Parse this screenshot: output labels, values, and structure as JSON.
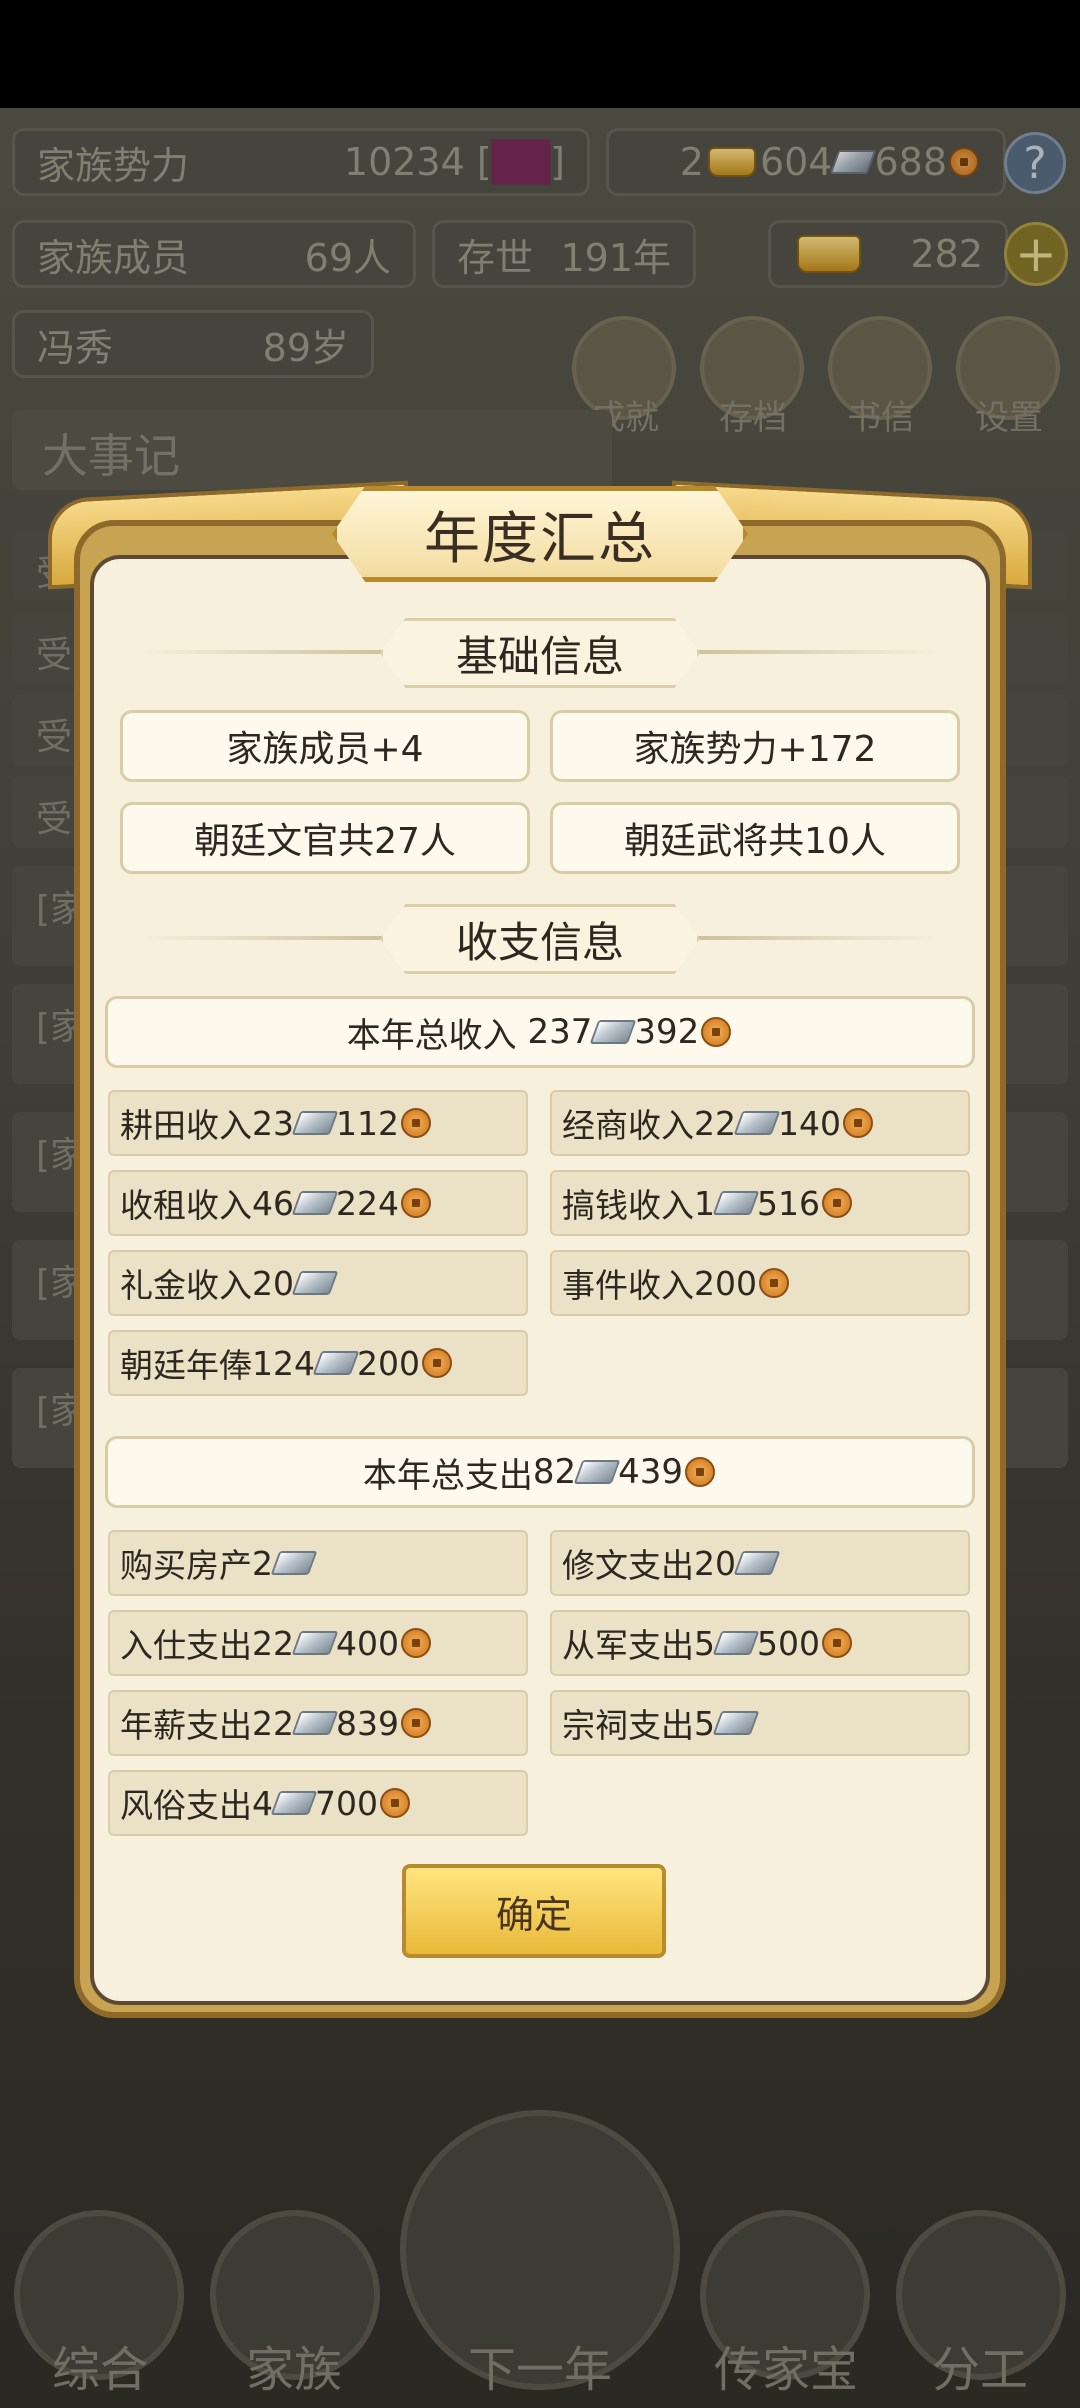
{
  "hud": {
    "power_label": "家族势力",
    "power_value": "10234",
    "power_rank_open": "[",
    "power_rank": "██",
    "power_rank_close": "]",
    "gold": "2",
    "silver": "604",
    "coins": "688",
    "help": "?",
    "members_label": "家族成员",
    "members_value": "69人",
    "exist_label": "存世",
    "exist_value": "191年",
    "ingots": "282",
    "add": "+",
    "leader_name": "冯秀",
    "leader_age": "89岁",
    "menu": [
      "成就",
      "存档",
      "书信",
      "设置"
    ],
    "events_title": "大事记",
    "bg_rows": [
      "受",
      "受",
      "受",
      "受",
      "[家",
      "[家",
      "[家",
      "[家",
      "[家"
    ]
  },
  "modal": {
    "title": "年度汇总",
    "basic_header": "基础信息",
    "basic": [
      "家族成员+4",
      "家族势力+172",
      "朝廷文官共27人",
      "朝廷武将共10人"
    ],
    "finance_header": "收支信息",
    "income_total": {
      "label": "本年总收入",
      "silver": "237",
      "coins": "392"
    },
    "income_items": [
      {
        "label": "耕田收入",
        "silver": "23",
        "coins": "112"
      },
      {
        "label": "经商收入",
        "silver": "22",
        "coins": "140"
      },
      {
        "label": "收租收入",
        "silver": "46",
        "coins": "224"
      },
      {
        "label": "搞钱收入",
        "silver": "1",
        "coins": "516"
      },
      {
        "label": "礼金收入",
        "silver": "20",
        "coins": ""
      },
      {
        "label": "事件收入",
        "silver": "",
        "coins": "200"
      },
      {
        "label": "朝廷年俸",
        "silver": "124",
        "coins": "200"
      }
    ],
    "expense_total": {
      "label": "本年总支出",
      "silver": "82",
      "coins": "439"
    },
    "expense_items": [
      {
        "label": "购买房产",
        "silver": "2",
        "coins": ""
      },
      {
        "label": "修文支出",
        "silver": "20",
        "coins": ""
      },
      {
        "label": "入仕支出",
        "silver": "22",
        "coins": "400"
      },
      {
        "label": "从军支出",
        "silver": "5",
        "coins": "500"
      },
      {
        "label": "年薪支出",
        "silver": "22",
        "coins": "839"
      },
      {
        "label": "宗祠支出",
        "silver": "5",
        "coins": ""
      },
      {
        "label": "风俗支出",
        "silver": "4",
        "coins": "700"
      }
    ],
    "confirm": "确定"
  },
  "bottom_nav": [
    "综合",
    "家族",
    "下一年",
    "传家宝",
    "分工"
  ]
}
